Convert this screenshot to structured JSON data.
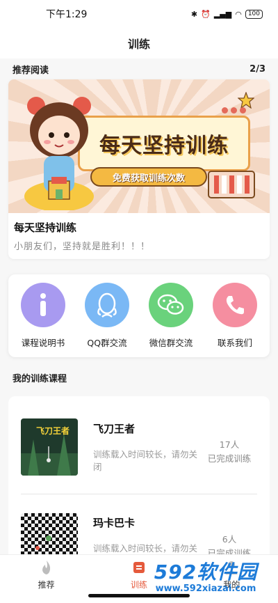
{
  "status_bar": {
    "time": "下午1:29",
    "battery": "100"
  },
  "header": {
    "title": "训练"
  },
  "reading": {
    "section_title": "推荐阅读",
    "pager": "2/3",
    "banner": {
      "headline": "每天坚持训练",
      "ribbon": "免费获取训练次数"
    },
    "article": {
      "title": "每天坚持训练",
      "subtitle": "小朋友们，坚持就是胜利！！！"
    }
  },
  "shortcuts": [
    {
      "label": "课程说明书",
      "icon": "info-icon",
      "color": "#a89af0"
    },
    {
      "label": "QQ群交流",
      "icon": "qq-penguin-icon",
      "color": "#7ab8f5"
    },
    {
      "label": "微信群交流",
      "icon": "wechat-icon",
      "color": "#6ad27c"
    },
    {
      "label": "联系我们",
      "icon": "phone-icon",
      "color": "#f58ea0"
    }
  ],
  "my_courses": {
    "section_title": "我的训练课程",
    "items": [
      {
        "name": "飞刀王者",
        "thumb_title": "飞刀王者",
        "desc": "训练载入时间较长，请勿关闭",
        "count": "17人",
        "status": "已完成训练"
      },
      {
        "name": "玛卡巴卡",
        "thumb_title": "",
        "desc": "训练载入时间较长，请勿关闭",
        "count": "6人",
        "status": "已完成训练"
      }
    ]
  },
  "tabs": [
    {
      "label": "推荐",
      "icon": "flame-icon",
      "active": false
    },
    {
      "label": "训练",
      "icon": "training-icon",
      "active": true
    },
    {
      "label": "我的",
      "icon": "user-icon",
      "active": false
    }
  ],
  "watermark": {
    "brand": "592软件园",
    "url": "www.592xiazai.com"
  },
  "colors": {
    "accent": "#e55a3c",
    "watermark": "#1d7bd8"
  }
}
